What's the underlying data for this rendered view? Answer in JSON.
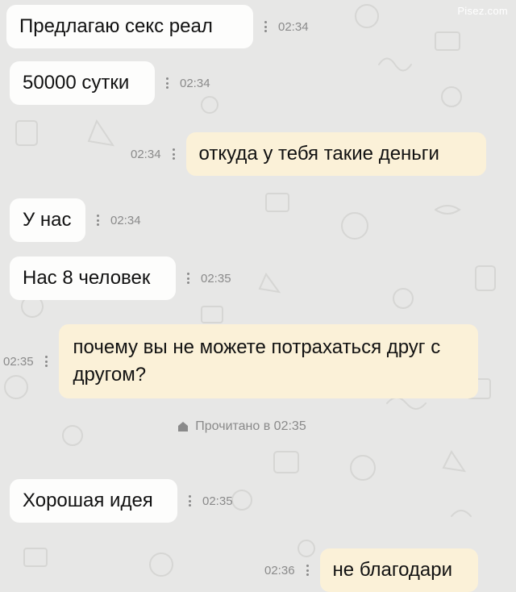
{
  "watermark": "Pisez.com",
  "messages": [
    {
      "text": "Предлагаю секс реал",
      "time": "02:34",
      "side": "in"
    },
    {
      "text": "50000 сутки",
      "time": "02:34",
      "side": "in"
    },
    {
      "text": "откуда у тебя такие деньги",
      "time": "02:34",
      "side": "out"
    },
    {
      "text": "У нас",
      "time": "02:34",
      "side": "in"
    },
    {
      "text": "Нас 8 человек",
      "time": "02:35",
      "side": "in"
    },
    {
      "text": "почему вы не можете потрахаться друг с другом?",
      "time": "02:35",
      "side": "out"
    },
    {
      "text": "Хорошая идея",
      "time": "02:35",
      "side": "in"
    },
    {
      "text": "не благодари",
      "time": "02:36",
      "side": "out"
    }
  ],
  "read_receipt": "Прочитано в 02:35",
  "colors": {
    "background": "#e7e7e6",
    "incoming_bubble": "#fdfdfc",
    "outgoing_bubble": "#fbf1d8",
    "meta_text": "#8a8a8a"
  }
}
